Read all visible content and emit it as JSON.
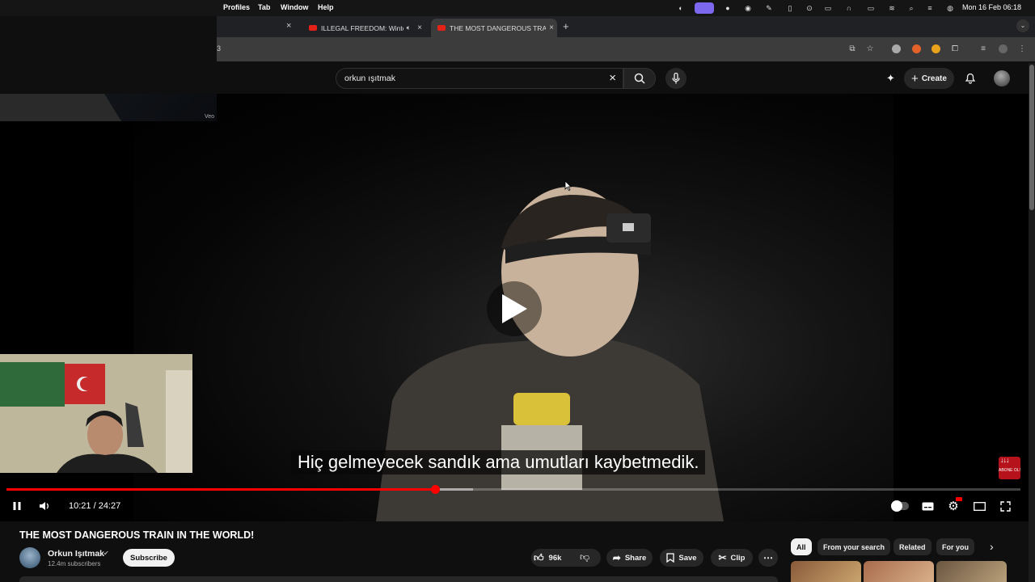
{
  "menubar": {
    "items": [
      "Profiles",
      "Tab",
      "Window",
      "Help"
    ],
    "clock": "Mon 16 Feb  06:18"
  },
  "tabs": [
    {
      "title": "ILLEGAL FREEDOM: Winter",
      "active": false
    },
    {
      "title": "THE MOST DANGEROUS TRAIN",
      "active": true
    }
  ],
  "address": {
    "fragment": "3"
  },
  "header": {
    "search_value": "orkun ışıtmak",
    "create_label": "Create"
  },
  "webcam": {
    "top_label": "Veo"
  },
  "player": {
    "subtitle": "Hiç gelmeyecek sandık ama umutları kaybetmedik.",
    "time": "10:21 / 24:27",
    "progress_fraction": 0.4226,
    "buffer_fraction": 0.46,
    "sticker_text": "ABONE OL!"
  },
  "video": {
    "title": "THE MOST DANGEROUS TRAIN IN THE WORLD!",
    "channel": "Orkun Işıtmak",
    "subscribers": "12.4m subscribers",
    "subscribe_label": "Subscribe",
    "likes": "96k",
    "share_label": "Share",
    "save_label": "Save",
    "clip_label": "Clip"
  },
  "chips": [
    "All",
    "From your search",
    "Related",
    "For you"
  ],
  "colors": {
    "accent": "#ff0000",
    "background": "#0f0f0f",
    "chip_bg": "#272727"
  }
}
